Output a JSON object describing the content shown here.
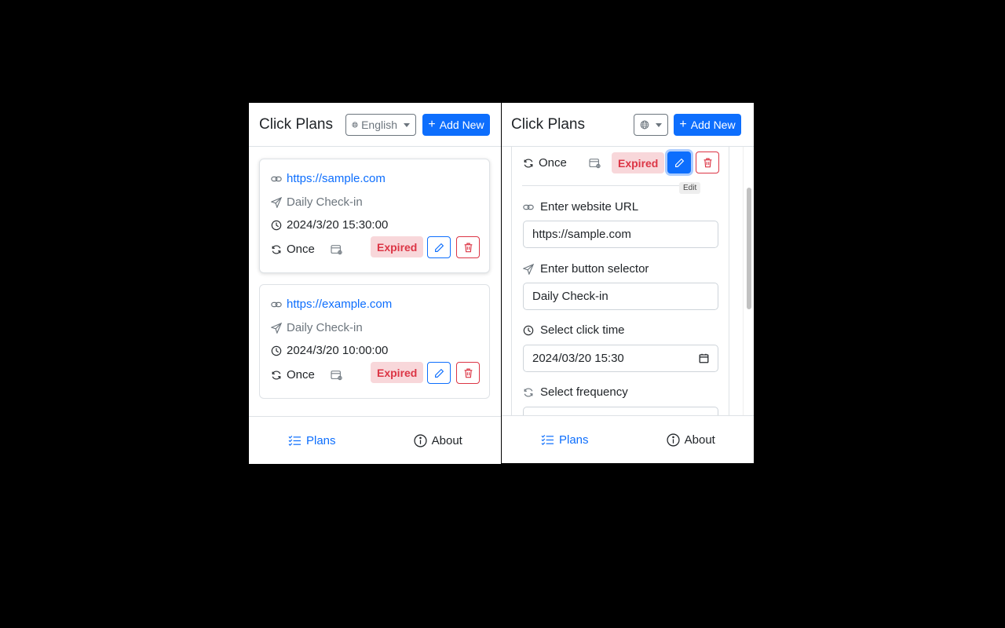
{
  "left": {
    "header": {
      "title": "Click Plans",
      "language": "English",
      "add_label": "Add New"
    },
    "plans": [
      {
        "url": "https://sample.com",
        "selector": "Daily Check-in",
        "time": "2024/3/20 15:30:00",
        "frequency": "Once",
        "status": "Expired"
      },
      {
        "url": "https://example.com",
        "selector": "Daily Check-in",
        "time": "2024/3/20 10:00:00",
        "frequency": "Once",
        "status": "Expired"
      }
    ],
    "footer": {
      "plans_label": "Plans",
      "about_label": "About"
    }
  },
  "right": {
    "header": {
      "title": "Click Plans",
      "add_label": "Add New"
    },
    "current": {
      "frequency": "Once",
      "status": "Expired",
      "tooltip": "Edit"
    },
    "form": {
      "url_label": "Enter website URL",
      "url_value": "https://sample.com",
      "selector_label": "Enter button selector",
      "selector_value": "Daily Check-in",
      "time_label": "Select click time",
      "time_value": "2024/03/20 15:30",
      "frequency_label": "Select frequency"
    },
    "footer": {
      "plans_label": "Plans",
      "about_label": "About"
    }
  },
  "colors": {
    "primary": "#0d6efd",
    "danger": "#dc3545",
    "expired_bg": "#f8d7da"
  }
}
